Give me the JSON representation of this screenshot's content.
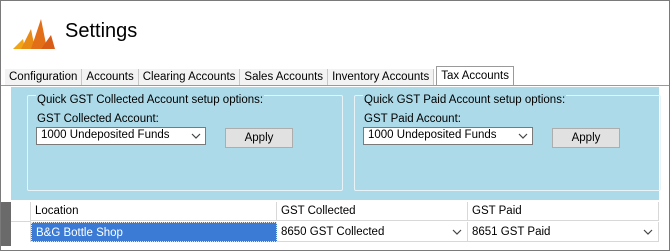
{
  "header": {
    "title": "Settings"
  },
  "tabs": [
    {
      "label": "Configuration"
    },
    {
      "label": "Accounts"
    },
    {
      "label": "Clearing Accounts"
    },
    {
      "label": "Sales Accounts"
    },
    {
      "label": "Inventory Accounts"
    },
    {
      "label": "Tax Accounts"
    }
  ],
  "collected": {
    "legend": "Quick GST Collected Account setup options:",
    "label": "GST Collected Account:",
    "value": "1000 Undeposited Funds",
    "apply": "Apply"
  },
  "paid": {
    "legend": "Quick GST Paid Account setup options:",
    "label": "GST Paid Account:",
    "value": "1000 Undeposited Funds",
    "apply": "Apply"
  },
  "grid": {
    "columns": [
      "Location",
      "GST Collected",
      "GST Paid"
    ],
    "rows": [
      {
        "location": "B&G Bottle Shop",
        "gst_collected": "8650 GST Collected",
        "gst_paid": "8651 GST Paid"
      }
    ]
  },
  "colors": {
    "panel": "#addae8",
    "selection": "#3b7bd6"
  }
}
